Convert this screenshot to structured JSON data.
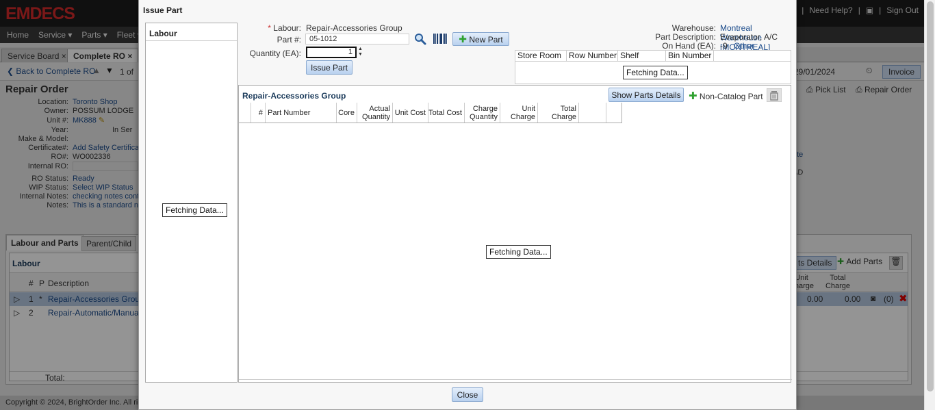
{
  "app": {
    "logo": "EMDECS",
    "header_links": [
      "...",
      "|",
      "Need Help?",
      "|",
      "|",
      "Sign Out"
    ],
    "menu": [
      "Home",
      "Service",
      "Parts",
      "Fleet"
    ],
    "tabs": [
      "Service Board",
      "Complete RO"
    ],
    "back_link": "Back to Complete RO",
    "page_counter": "1 of",
    "date": "29/01/2024",
    "invoice_label": "Invoice",
    "pick_list_label": "Pick List",
    "repair_order_label": "Repair Order",
    "ro": {
      "title": "Repair Order",
      "fields": [
        {
          "label": "Location:",
          "value": "Toronto Shop",
          "link": true
        },
        {
          "label": "Owner:",
          "value": "POSSUM LODGE",
          "link": false
        },
        {
          "label": "Unit #:",
          "value": "MK888",
          "link": true
        },
        {
          "label": "Year:",
          "value": "In Ser",
          "link": false
        },
        {
          "label": "Make & Model:",
          "value": "",
          "link": false
        },
        {
          "label": "Certificate#:",
          "value": "Add Safety Certifica",
          "link": true
        },
        {
          "label": "RO#:",
          "value": "WO002336",
          "link": false
        },
        {
          "label": "Internal RO:",
          "value": "",
          "link": false
        },
        {
          "label": "RO Status:",
          "value": "Ready",
          "link": true
        },
        {
          "label": "WIP Status:",
          "value": "Select WIP Status",
          "link": true
        },
        {
          "label": "Internal Notes:",
          "value": "checking notes cont",
          "link": true
        },
        {
          "label": "Notes:",
          "value": "This is a standard n",
          "link": true
        }
      ]
    },
    "lower": {
      "tabs": [
        "Labour and Parts",
        "Parent/Child"
      ],
      "section": "Labour",
      "columns": [
        "#",
        "P",
        "Description"
      ],
      "rows": [
        {
          "num": "1",
          "p": "*",
          "desc": "Repair-Accessories Group"
        },
        {
          "num": "2",
          "p": "",
          "desc": "Repair-Automatic/Manual C"
        }
      ],
      "total_label": "Total:",
      "right_actions": [
        "ts Details",
        "Add Parts"
      ],
      "right_columns": [
        "Unit Charge",
        "Total Charge"
      ],
      "right_row": {
        "unit_charge": "0.00",
        "total_charge": "0.00",
        "count": "(0)"
      },
      "side_text": [
        "ate",
        "AD"
      ]
    },
    "footer": "Copyright © 2024, BrightOrder Inc. All rights"
  },
  "modal": {
    "title": "Issue Part",
    "labour_heading": "Labour",
    "fetching_text": "Fetching Data...",
    "form": {
      "labour_label": "Labour:",
      "labour_required_mark": "*",
      "labour_value": "Repair-Accessories Group",
      "part_label": "Part #:",
      "part_value": "05-1012",
      "quantity_label": "Quantity (EA):",
      "quantity_value": "1",
      "issue_part_button": "Issue Part",
      "new_part_button": "New Part",
      "warehouse_label": "Warehouse:",
      "warehouse_value": "Montreal Warehouse [MONTREAL]",
      "part_desc_label": "Part Description:",
      "part_desc_value": "Evaporator, A/C",
      "on_hand_label": "On Hand (EA):",
      "on_hand_value": "-9",
      "other_warehouses_link": "Other warehouses on hand",
      "stock_columns": [
        "Store Room",
        "Row Number",
        "Shelf",
        "Bin Number"
      ]
    },
    "parts_grid": {
      "heading": "Repair-Accessories Group",
      "show_details_button": "Show Parts Details",
      "non_catalog_button": "Non-Catalog Part",
      "columns": [
        "#",
        "Part Number",
        "Core",
        "Actual Quantity",
        "Unit Cost",
        "Total Cost",
        "Charge Quantity",
        "Unit Charge",
        "Total Charge"
      ]
    },
    "close_button": "Close"
  },
  "colors": {
    "accent": "#1a4a8a",
    "logo_red": "#d42a2a",
    "button_gradient_top": "#e3eefb",
    "button_gradient_bottom": "#b9d1ef",
    "add_green": "#2fa12f"
  }
}
